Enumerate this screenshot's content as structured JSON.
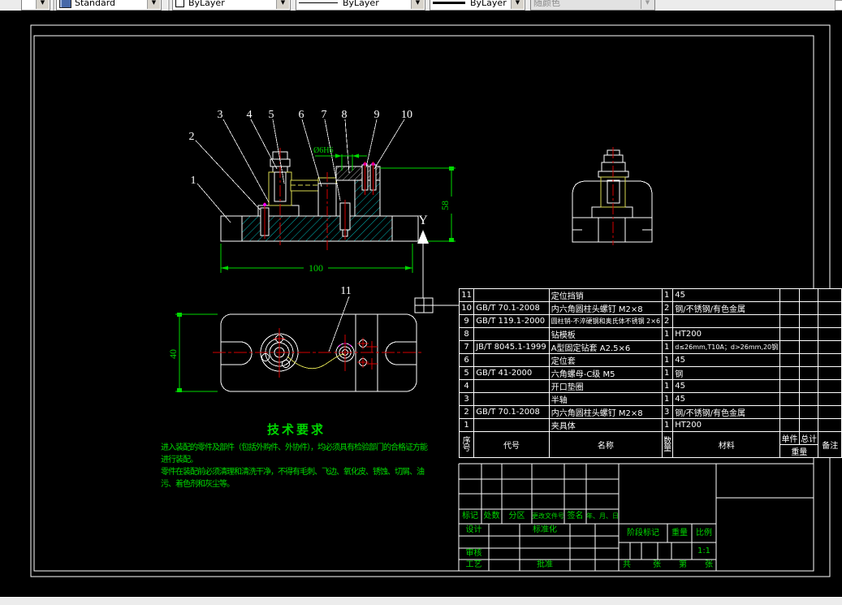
{
  "toolbar": {
    "style_label": "Standard",
    "color_label": "ByLayer",
    "linetype_label": "ByLayer",
    "lineweight_label": "ByLayer",
    "plotstyle_label": "随颜色"
  },
  "drawing": {
    "callouts": [
      "1",
      "2",
      "3",
      "4",
      "5",
      "6",
      "7",
      "8",
      "9",
      "10",
      "11"
    ],
    "dimensions": {
      "base_width": "100",
      "height": "58",
      "plate_height": "40",
      "hole": "Ø6H6"
    },
    "datum_label": "Y"
  },
  "tech_req": {
    "title": "技术要求",
    "lines": [
      "进入装配的零件及部件（包括外购件、外协件），均必须具有检验部门的合格证方能",
      "进行装配。",
      "零件在装配前必须清理和清洗干净，不得有毛刺、飞边、氧化皮、锈蚀、切屑、油",
      "污、着色剂和灰尘等。"
    ]
  },
  "bom": {
    "headers": {
      "no": "序号",
      "code": "代号",
      "name": "名称",
      "qty": "数量",
      "material": "材料",
      "unit": "单件",
      "total": "总计",
      "weight": "重量",
      "remark": "备注"
    },
    "rows": [
      {
        "no": "11",
        "code": "",
        "name": "定位挡销",
        "qty": "1",
        "material": "45",
        "remark": ""
      },
      {
        "no": "10",
        "code": "GB/T 70.1-2008",
        "name": "内六角圆柱头螺钉 M2×8",
        "qty": "2",
        "material": "钢/不锈钢/有色金属",
        "remark": ""
      },
      {
        "no": "9",
        "code": "GB/T 119.1-2000",
        "name": "圆柱销-不淬硬钢和奥氏体不锈钢 2×6",
        "qty": "2",
        "material": "",
        "remark": ""
      },
      {
        "no": "8",
        "code": "",
        "name": "钻模板",
        "qty": "1",
        "material": "HT200",
        "remark": ""
      },
      {
        "no": "7",
        "code": "JB/T 8045.1-1999",
        "name": "A型固定钻套 A2.5×6",
        "qty": "1",
        "material": "d≤26mm,T10A；d>26mm,20钢",
        "remark": ""
      },
      {
        "no": "6",
        "code": "",
        "name": "定位套",
        "qty": "1",
        "material": "45",
        "remark": ""
      },
      {
        "no": "5",
        "code": "GB/T 41-2000",
        "name": "六角螺母-C级 M5",
        "qty": "1",
        "material": "钢",
        "remark": ""
      },
      {
        "no": "4",
        "code": "",
        "name": "开口垫圈",
        "qty": "1",
        "material": "45",
        "remark": ""
      },
      {
        "no": "3",
        "code": "",
        "name": "半轴",
        "qty": "1",
        "material": "45",
        "remark": ""
      },
      {
        "no": "2",
        "code": "GB/T 70.1-2008",
        "name": "内六角圆柱头螺钉 M2×8",
        "qty": "3",
        "material": "钢/不锈钢/有色金属",
        "remark": ""
      },
      {
        "no": "1",
        "code": "",
        "name": "夹具体",
        "qty": "1",
        "material": "HT200",
        "remark": ""
      }
    ]
  },
  "titleblock": {
    "rev_headers": [
      "标记",
      "处数",
      "分区",
      "更改文件号",
      "签名",
      "年、月、日"
    ],
    "design": "设计",
    "standardization": "标准化",
    "check": "审核",
    "process": "工艺",
    "approve": "批准",
    "stage_mark": "阶段标记",
    "weight": "重量",
    "scale": "比例",
    "scale_value": "1:1",
    "sheet_total": "共",
    "sheet_unit1": "张",
    "sheet_no": "第",
    "sheet_unit2": "张"
  },
  "colors": {
    "dim_green": "#00d800",
    "line_white": "#ffffff",
    "centerline_red": "#d40000",
    "hatch_cyan": "#00caca",
    "part_yellow": "#d8d850",
    "accent_magenta": "#ff00ff"
  }
}
